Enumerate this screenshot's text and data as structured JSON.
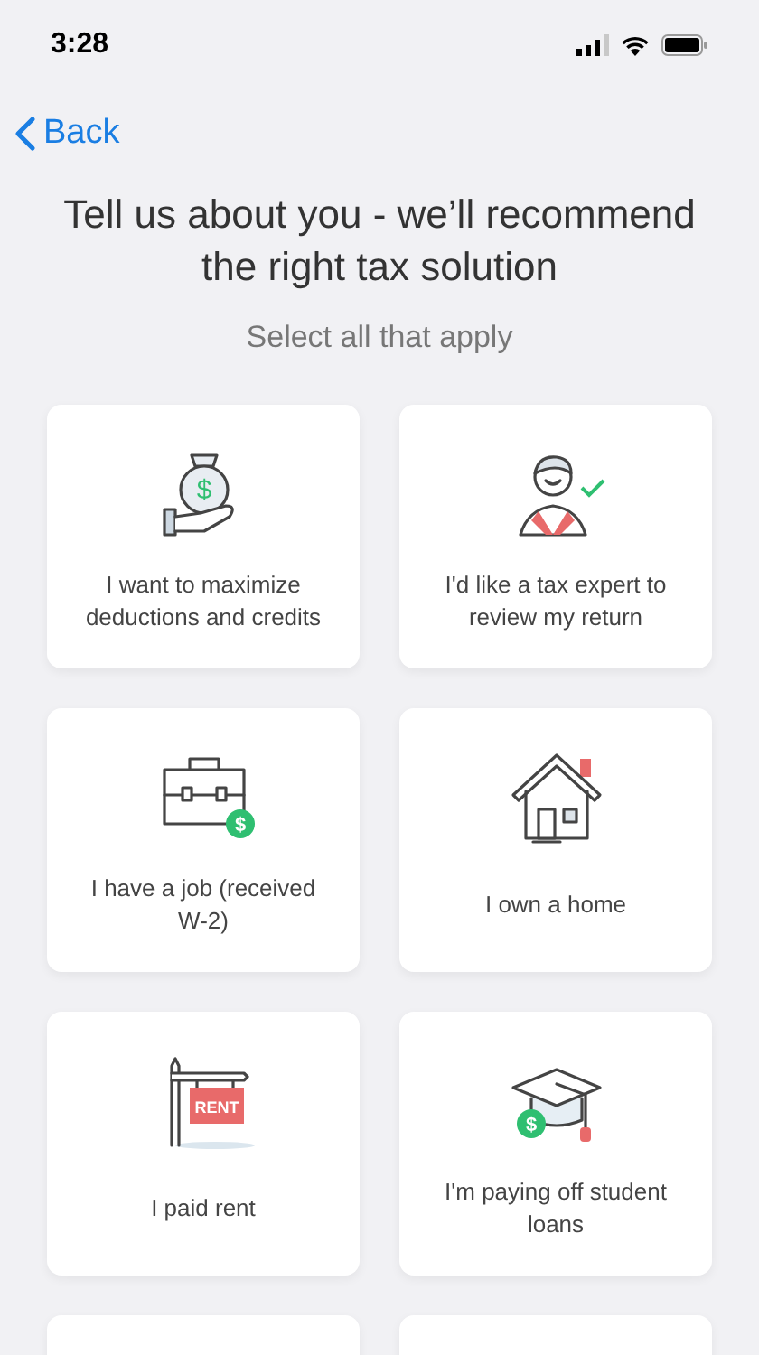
{
  "status_bar": {
    "time": "3:28"
  },
  "nav": {
    "back": "Back"
  },
  "title": "Tell us about you - we’ll recommend the right tax solution",
  "subtitle": "Select all that apply",
  "cards": [
    {
      "kind": "money_hand",
      "label": "I want to maximize deductions and credits",
      "symbol": "$",
      "selected": false
    },
    {
      "kind": "expert",
      "label": "I'd like a tax expert to review my return",
      "selected": false
    },
    {
      "kind": "briefcase",
      "label": "I have a job (received W-2)",
      "symbol": "$",
      "selected": false
    },
    {
      "kind": "house",
      "label": "I own a home",
      "selected": false
    },
    {
      "kind": "rent_sign",
      "label": "I paid rent",
      "sign_text": "RENT",
      "selected": false
    },
    {
      "kind": "grad_cap",
      "label": "I'm paying off student loans",
      "symbol": "$",
      "selected": false
    },
    {
      "kind": "cut_off"
    },
    {
      "kind": "cut_off"
    }
  ]
}
